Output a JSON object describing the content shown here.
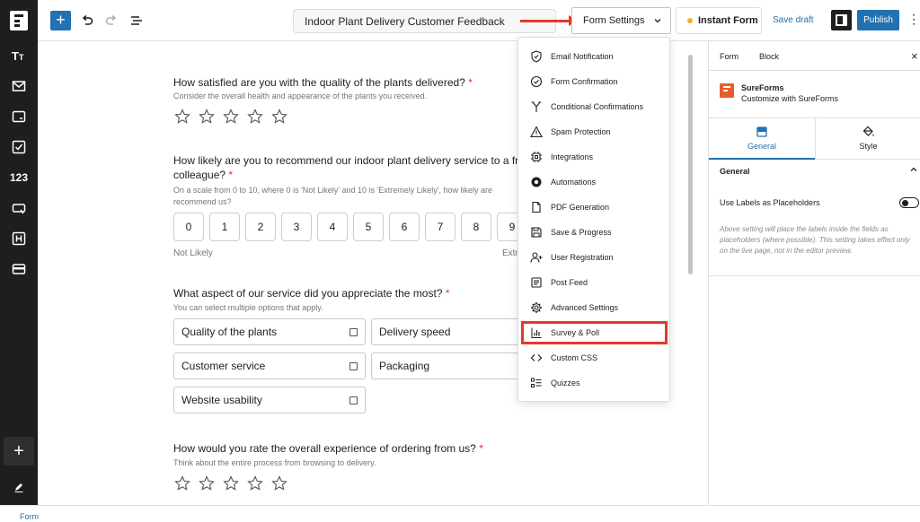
{
  "toolbar": {
    "title": "Indoor Plant Delivery Customer Feedback",
    "form_settings": "Form Settings",
    "instant_form": "Instant Form",
    "save_draft": "Save draft",
    "publish": "Publish"
  },
  "sidebar": {
    "tools": [
      "text-icon",
      "email-icon",
      "input-icon",
      "checkbox-icon",
      "number-icon",
      "button-icon",
      "heading-icon",
      "card-icon"
    ],
    "number_label": "123"
  },
  "questions": {
    "q1": {
      "title": "How satisfied are you with the quality of the plants delivered?",
      "required": "*",
      "help": "Consider the overall health and appearance of the plants you received.",
      "stars": 5
    },
    "q2": {
      "title_line1": "How likely are you to recommend our indoor plant delivery service to a friend",
      "title_line2": "colleague?",
      "required": "*",
      "help_line1": "On a scale from 0 to 10, where 0 is 'Not Likely' and 10 is 'Extremely Likely', how likely are",
      "help_line2": "recommend us?",
      "scale": [
        "0",
        "1",
        "2",
        "3",
        "4",
        "5",
        "6",
        "7",
        "8",
        "9"
      ],
      "low_label": "Not Likely",
      "high_label": "Extr"
    },
    "q3": {
      "title": "What aspect of our service did you appreciate the most?",
      "required": "*",
      "help": "You can select multiple options that apply.",
      "options": [
        "Quality of the plants",
        "Delivery speed",
        "Customer service",
        "Packaging",
        "Website usability"
      ]
    },
    "q4": {
      "title": "How would you rate the overall experience of ordering from us?",
      "required": "*",
      "help": "Think about the entire process from browsing to delivery.",
      "stars": 5
    }
  },
  "dropdown": {
    "items": [
      {
        "label": "Email Notification",
        "icon": "shield-check-icon"
      },
      {
        "label": "Form Confirmation",
        "icon": "check-circle-icon"
      },
      {
        "label": "Conditional Confirmations",
        "icon": "branch-icon"
      },
      {
        "label": "Spam Protection",
        "icon": "warning-icon"
      },
      {
        "label": "Integrations",
        "icon": "chip-icon"
      },
      {
        "label": "Automations",
        "icon": "automation-icon"
      },
      {
        "label": "PDF Generation",
        "icon": "document-icon"
      },
      {
        "label": "Save & Progress",
        "icon": "save-icon"
      },
      {
        "label": "User Registration",
        "icon": "user-plus-icon"
      },
      {
        "label": "Post Feed",
        "icon": "post-icon"
      },
      {
        "label": "Advanced Settings",
        "icon": "gear-icon"
      },
      {
        "label": "Survey & Poll",
        "icon": "bar-chart-icon"
      },
      {
        "label": "Custom CSS",
        "icon": "code-icon"
      },
      {
        "label": "Quizzes",
        "icon": "list-icon"
      }
    ],
    "highlighted": "Survey & Poll"
  },
  "right_panel": {
    "tab_form": "Form",
    "tab_block": "Block",
    "brand_name": "SureForms",
    "brand_sub": "Customize with SureForms",
    "seg_general": "General",
    "seg_style": "Style",
    "section": "General",
    "setting_label": "Use Labels as Placeholders",
    "setting_help": "Above setting will place the labels inside the fields as placeholders (where possible). This setting takes effect only on the live page, not in the editor preview."
  },
  "statusbar": {
    "breadcrumb": "Form"
  },
  "colors": {
    "accent": "#2271b1",
    "annotation": "#e5392f",
    "brand": "#e85d2c",
    "sidebar": "#1e1e1e"
  }
}
